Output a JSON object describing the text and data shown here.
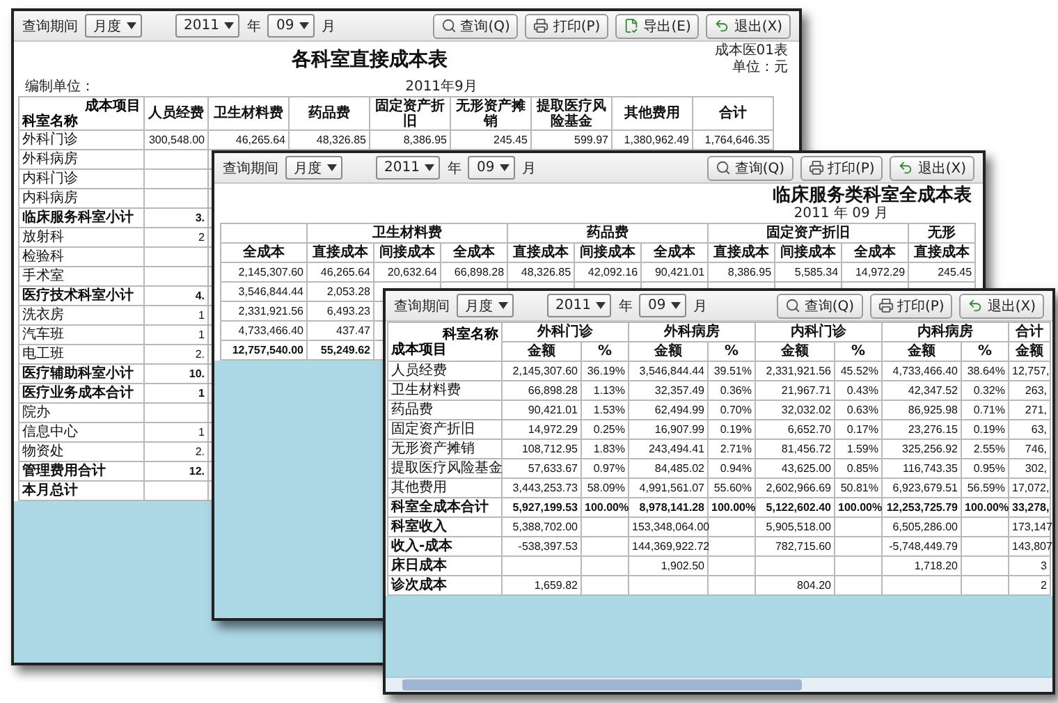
{
  "back_window": {
    "toolbar": {
      "period_label": "查询期间",
      "period_type": "月度",
      "year": "2011",
      "year_unit": "年",
      "month": "09",
      "month_unit": "月"
    },
    "buttons": [
      {
        "label": "查询(Q)",
        "kind": "search"
      },
      {
        "label": "打印(P)",
        "kind": "print"
      },
      {
        "label": "导出(E)",
        "kind": "export"
      },
      {
        "label": "退出(X)",
        "kind": "exit"
      }
    ],
    "title": "各科室直接成本表",
    "form_no": "成本医01表",
    "unit": "单位：元",
    "org_label": "编制单位：",
    "date": "2011年9月",
    "corner_top": "成本项目",
    "corner_bottom": "科室名称",
    "columns": [
      "人员经费",
      "卫生材料费",
      "药品费",
      "固定资产折旧",
      "无形资产摊销",
      "提取医疗风险基金",
      "其他费用",
      "合计"
    ],
    "rows": [
      {
        "name": "外科门诊",
        "bold": false,
        "values": [
          "300,548.00",
          "46,265.64",
          "48,326.85",
          "8,386.95",
          "245.45",
          "599.97",
          "1,380,962.49",
          "1,764,646.35"
        ]
      },
      {
        "name": "外科病房",
        "bold": false,
        "values": []
      },
      {
        "name": "内科门诊",
        "bold": false,
        "values": []
      },
      {
        "name": "内科病房",
        "bold": false,
        "values": []
      },
      {
        "name": "临床服务科室小计",
        "bold": true,
        "values": [
          "3."
        ]
      },
      {
        "name": "放射科",
        "bold": false,
        "values": [
          "2"
        ]
      },
      {
        "name": "检验科",
        "bold": false,
        "values": []
      },
      {
        "name": "手术室",
        "bold": false,
        "values": []
      },
      {
        "name": "医疗技术科室小计",
        "bold": true,
        "values": [
          "4."
        ]
      },
      {
        "name": "洗衣房",
        "bold": false,
        "values": [
          "1"
        ]
      },
      {
        "name": "汽车班",
        "bold": false,
        "values": [
          "1"
        ]
      },
      {
        "name": "电工班",
        "bold": false,
        "values": [
          "2."
        ]
      },
      {
        "name": "医疗辅助科室小计",
        "bold": true,
        "values": [
          "10."
        ]
      },
      {
        "name": "医疗业务成本合计",
        "bold": true,
        "values": [
          "1"
        ]
      },
      {
        "name": "院办",
        "bold": false,
        "values": []
      },
      {
        "name": "信息中心",
        "bold": false,
        "values": [
          "1"
        ]
      },
      {
        "name": "物资处",
        "bold": false,
        "values": [
          "2."
        ]
      },
      {
        "name": "管理费用合计",
        "bold": true,
        "values": [
          "12."
        ]
      },
      {
        "name": "本月总计",
        "bold": true,
        "values": []
      }
    ]
  },
  "middle_window": {
    "toolbar": {
      "period_label": "查询期间",
      "period_type": "月度",
      "year": "2011",
      "year_unit": "年",
      "month": "09",
      "month_unit": "月"
    },
    "buttons": [
      {
        "label": "查询(Q)",
        "kind": "search"
      },
      {
        "label": "打印(P)",
        "kind": "print"
      },
      {
        "label": "退出(X)",
        "kind": "exit"
      }
    ],
    "title": "临床服务类科室全成本表",
    "date": "2011 年 09 月",
    "first_column": "全成本",
    "groups": [
      {
        "label": "卫生材料费",
        "columns": [
          "直接成本",
          "间接成本",
          "全成本"
        ]
      },
      {
        "label": "药品费",
        "columns": [
          "直接成本",
          "间接成本",
          "全成本"
        ]
      },
      {
        "label": "固定资产折旧",
        "columns": [
          "直接成本",
          "间接成本",
          "全成本"
        ]
      },
      {
        "label": "无形",
        "columns": [
          "直接成本"
        ]
      }
    ],
    "rows": [
      {
        "bold": false,
        "values": [
          "2,145,307.60",
          "46,265.64",
          "20,632.64",
          "66,898.28",
          "48,326.85",
          "42,092.16",
          "90,421.01",
          "8,386.95",
          "5,585.34",
          "14,972.29",
          "245.45"
        ]
      },
      {
        "bold": false,
        "values": [
          "3,546,844.44",
          "2,053.28"
        ]
      },
      {
        "bold": false,
        "values": [
          "2,331,921.56",
          "6,493.23"
        ]
      },
      {
        "bold": false,
        "values": [
          "4,733,466.40",
          "437.47"
        ]
      },
      {
        "bold": true,
        "values": [
          "12,757,540.00",
          "55,249.62"
        ]
      }
    ]
  },
  "front_window": {
    "toolbar": {
      "period_label": "查询期间",
      "period_type": "月度",
      "year": "2011",
      "year_unit": "年",
      "month": "09",
      "month_unit": "月"
    },
    "buttons": [
      {
        "label": "查询(Q)",
        "kind": "search"
      },
      {
        "label": "打印(P)",
        "kind": "print"
      },
      {
        "label": "退出(X)",
        "kind": "exit"
      }
    ],
    "corner_top": "科室名称",
    "corner_bottom": "成本项目",
    "departments": [
      {
        "name": "外科门诊",
        "amount_label": "金额",
        "pct_label": "%"
      },
      {
        "name": "外科病房",
        "amount_label": "金额",
        "pct_label": "%"
      },
      {
        "name": "内科门诊",
        "amount_label": "金额",
        "pct_label": "%"
      },
      {
        "name": "内科病房",
        "amount_label": "金额",
        "pct_label": "%"
      }
    ],
    "partial_column": {
      "name": "合计",
      "amount_label": "金额"
    },
    "rows": [
      {
        "name": "人员经费",
        "kind": "item",
        "cells": [
          "2,145,307.60",
          "36.19%",
          "3,546,844.44",
          "39.51%",
          "2,331,921.56",
          "45.52%",
          "4,733,466.40",
          "38.64%",
          "12,757,"
        ]
      },
      {
        "name": "卫生材料费",
        "kind": "item",
        "cells": [
          "66,898.28",
          "1.13%",
          "32,357.49",
          "0.36%",
          "21,967.71",
          "0.43%",
          "42,347.52",
          "0.32%",
          "263,"
        ]
      },
      {
        "name": "药品费",
        "kind": "item",
        "cells": [
          "90,421.01",
          "1.53%",
          "62,494.99",
          "0.70%",
          "32,032.02",
          "0.63%",
          "86,925.98",
          "0.71%",
          "271,"
        ]
      },
      {
        "name": "固定资产折旧",
        "kind": "item",
        "cells": [
          "14,972.29",
          "0.25%",
          "16,907.99",
          "0.19%",
          "6,652.70",
          "0.17%",
          "23,276.15",
          "0.19%",
          "63,"
        ]
      },
      {
        "name": "无形资产摊销",
        "kind": "item",
        "cells": [
          "108,712.95",
          "1.83%",
          "243,494.41",
          "2.71%",
          "81,456.72",
          "1.59%",
          "325,256.92",
          "2.55%",
          "746,"
        ]
      },
      {
        "name": "提取医疗风险基金",
        "kind": "item",
        "cells": [
          "57,633.67",
          "0.97%",
          "84,485.02",
          "0.94%",
          "43,625.00",
          "0.85%",
          "116,743.35",
          "0.95%",
          "302,"
        ]
      },
      {
        "name": "其他费用",
        "kind": "item",
        "cells": [
          "3,443,253.73",
          "58.09%",
          "4,991,561.07",
          "55.60%",
          "2,602,966.69",
          "50.81%",
          "6,923,679.51",
          "56.59%",
          "17,072,"
        ]
      },
      {
        "name": "科室全成本合计",
        "kind": "total",
        "cells": [
          "5,927,199.53",
          "100.00%",
          "8,978,141.28",
          "100.00%",
          "5,122,602.40",
          "100.00%",
          "12,253,725.79",
          "100.00%",
          "33,278,"
        ]
      },
      {
        "name": "科室收入",
        "kind": "summary",
        "cells": [
          "5,388,702.00",
          null,
          "153,348,064.00",
          null,
          "5,905,518.00",
          null,
          "6,505,286.00",
          null,
          "173,147"
        ]
      },
      {
        "name": "收入-成本",
        "kind": "summary",
        "cells": [
          "-538,397.53",
          null,
          "144,369,922.72",
          null,
          "782,715.60",
          null,
          "-5,748,449.79",
          null,
          "143,807"
        ]
      },
      {
        "name": "床日成本",
        "kind": "summary",
        "cells": [
          null,
          null,
          "1,902.50",
          null,
          null,
          null,
          "1,718.20",
          null,
          "3"
        ]
      },
      {
        "name": "诊次成本",
        "kind": "summary",
        "cells": [
          "1,659.82",
          null,
          null,
          null,
          "804.20",
          null,
          null,
          null,
          "2"
        ]
      }
    ]
  }
}
